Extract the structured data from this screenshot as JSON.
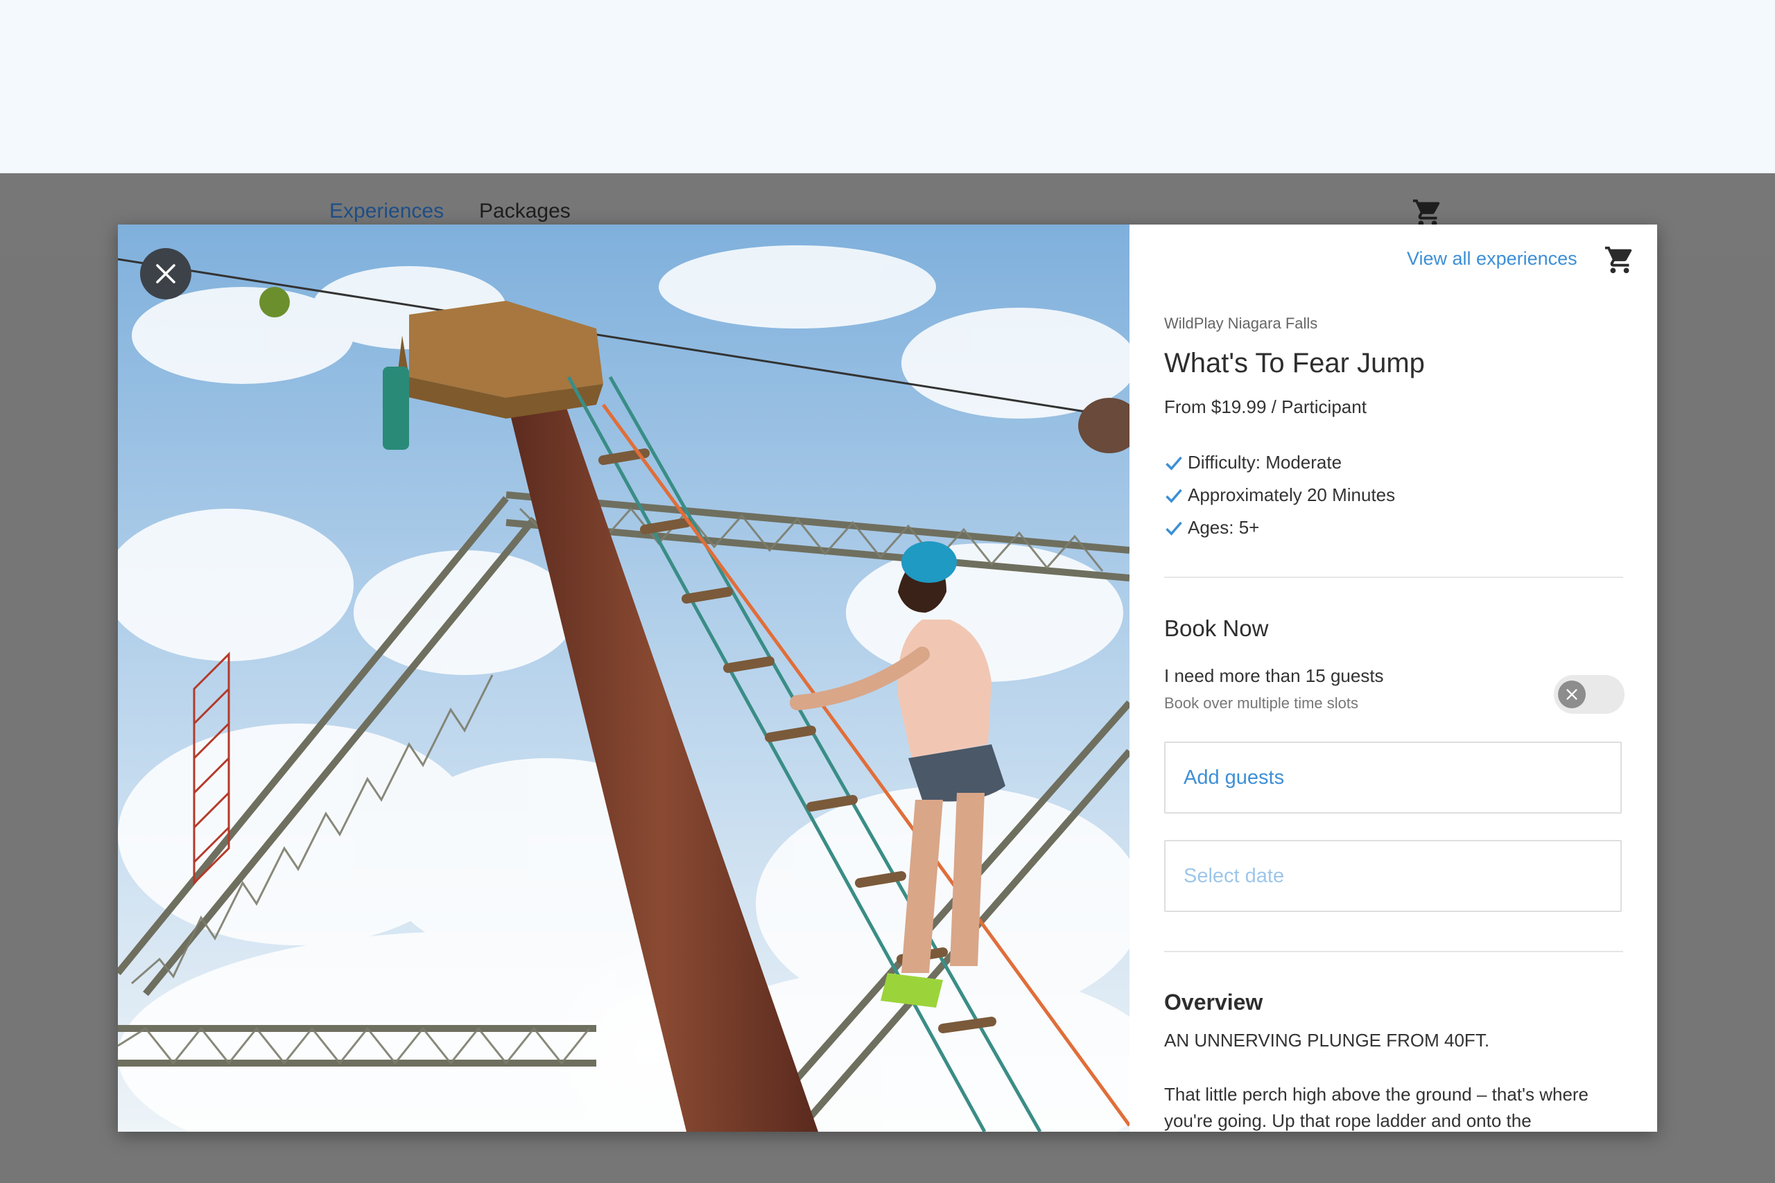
{
  "nav": {
    "items": [
      {
        "label": "Experiences",
        "active": true
      },
      {
        "label": "Packages",
        "active": false
      }
    ],
    "cart_icon": "shopping-cart-icon"
  },
  "modal": {
    "close_icon": "close-icon",
    "photo_description_icon": "photo",
    "panel": {
      "view_all_label": "View all experiences",
      "cart_icon": "shopping-cart-icon",
      "venue": "WildPlay Niagara Falls",
      "title": "What's To Fear Jump",
      "price": "From $19.99 / Participant",
      "features": [
        "Difficulty: Moderate",
        "Approximately 20 Minutes",
        "Ages: 5+"
      ],
      "book_now": {
        "heading": "Book Now",
        "large_group_label": "I need more than 15 guests",
        "large_group_sub": "Book over multiple time slots",
        "large_group_toggle_on": false,
        "add_guests_label": "Add guests",
        "select_date_label": "Select date"
      },
      "overview": {
        "heading": "Overview",
        "tagline": "AN UNNERVING PLUNGE FROM 40FT.",
        "body": "That little perch high above the ground – that's where you're going. Up that rope ladder and onto the"
      }
    }
  },
  "colors": {
    "accent": "#3d8fd6",
    "active_nav": "#1f4f88",
    "overlay": "#777777",
    "top_band": "#f3f9fc"
  }
}
